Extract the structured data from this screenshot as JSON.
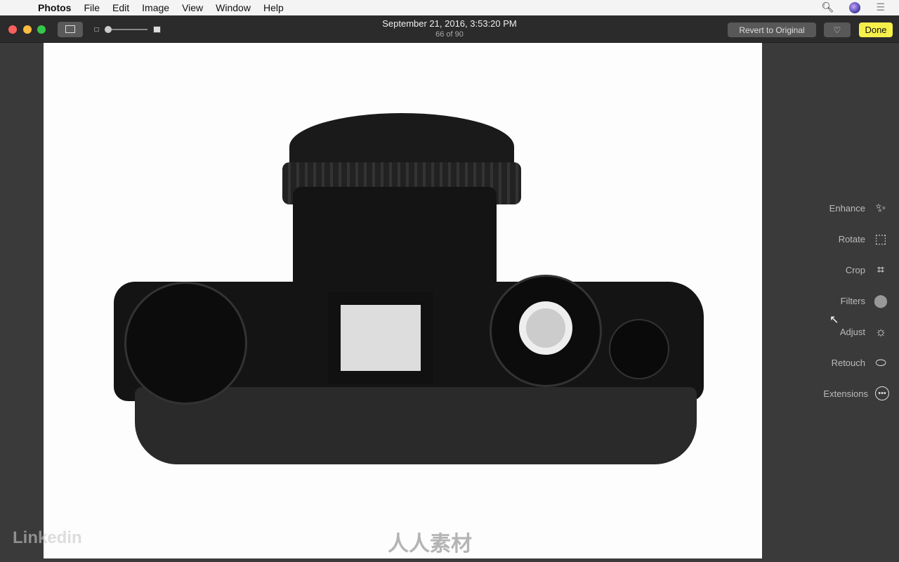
{
  "menubar": {
    "apple_icon": "apple-icon",
    "app": "Photos",
    "items": [
      "File",
      "Edit",
      "Image",
      "View",
      "Window",
      "Help"
    ]
  },
  "toolbar": {
    "date": "September 21, 2016, 3:53:20 PM",
    "position": "66 of 90",
    "revert": "Revert to Original",
    "favorite_icon": "heart-icon",
    "done": "Done",
    "zoom_slider_value": 0
  },
  "tools": [
    {
      "label": "Enhance",
      "icon": "magic-wand-icon"
    },
    {
      "label": "Rotate",
      "icon": "rotate-icon"
    },
    {
      "label": "Crop",
      "icon": "crop-icon"
    },
    {
      "label": "Filters",
      "icon": "filters-icon"
    },
    {
      "label": "Adjust",
      "icon": "adjust-icon"
    },
    {
      "label": "Retouch",
      "icon": "bandage-icon"
    },
    {
      "label": "Extensions",
      "icon": "more-icon"
    }
  ],
  "watermarks": {
    "linkedin": "Linkedin",
    "site": "人人素材"
  },
  "colors": {
    "done": "#f7f04a",
    "toolbar": "#2b2b2b",
    "panel": "#3a3a3a"
  }
}
